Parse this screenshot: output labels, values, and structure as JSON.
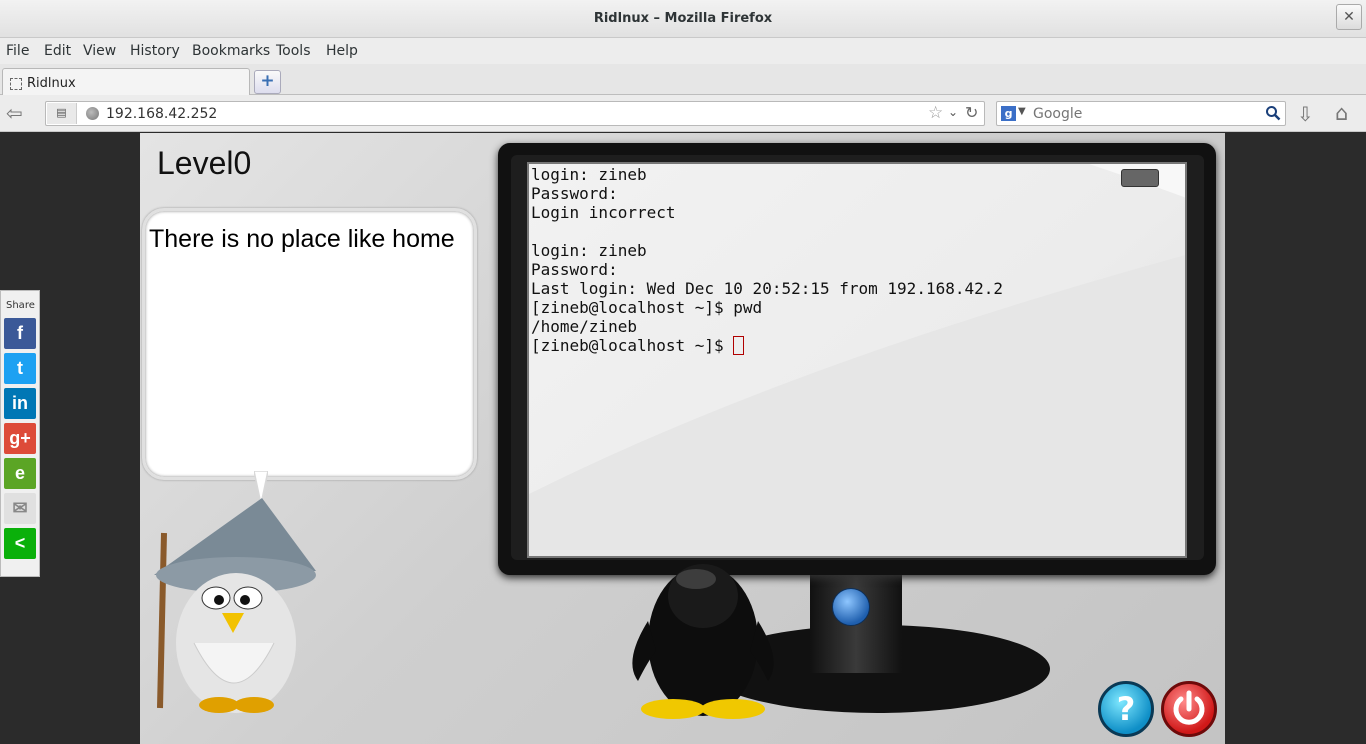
{
  "window": {
    "title": "Ridlnux – Mozilla Firefox",
    "close_glyph": "✕"
  },
  "menu": [
    "File",
    "Edit",
    "View",
    "History",
    "Bookmarks",
    "Tools",
    "Help"
  ],
  "tab": {
    "label": "Ridlnux",
    "new_tab_glyph": "+"
  },
  "nav": {
    "url": "192.168.42.252",
    "search_placeholder": "Google",
    "search_engine_glyph": "g"
  },
  "share": {
    "label": "Share",
    "buttons": [
      {
        "name": "facebook",
        "glyph": "f",
        "color": "#3b5998"
      },
      {
        "name": "twitter",
        "glyph": "t",
        "color": "#1da1f2"
      },
      {
        "name": "linkedin",
        "glyph": "in",
        "color": "#0077b5"
      },
      {
        "name": "googleplus",
        "glyph": "g+",
        "color": "#dd4b39"
      },
      {
        "name": "evernote",
        "glyph": "e",
        "color": "#5ba525"
      },
      {
        "name": "email",
        "glyph": "✉",
        "color": "#e0e0e0"
      },
      {
        "name": "share",
        "glyph": "<",
        "color": "#0ab00a"
      }
    ]
  },
  "page": {
    "level": "Level0",
    "bubble_text": "There is no place like home",
    "help_glyph": "?"
  },
  "terminal": {
    "lines": [
      "login: zineb",
      "Password:",
      "Login incorrect",
      "",
      "login: zineb",
      "Password:",
      "Last login: Wed Dec 10 20:52:15 from 192.168.42.2",
      "[zineb@localhost ~]$ pwd",
      "/home/zineb"
    ],
    "prompt": "[zineb@localhost ~]$ "
  }
}
